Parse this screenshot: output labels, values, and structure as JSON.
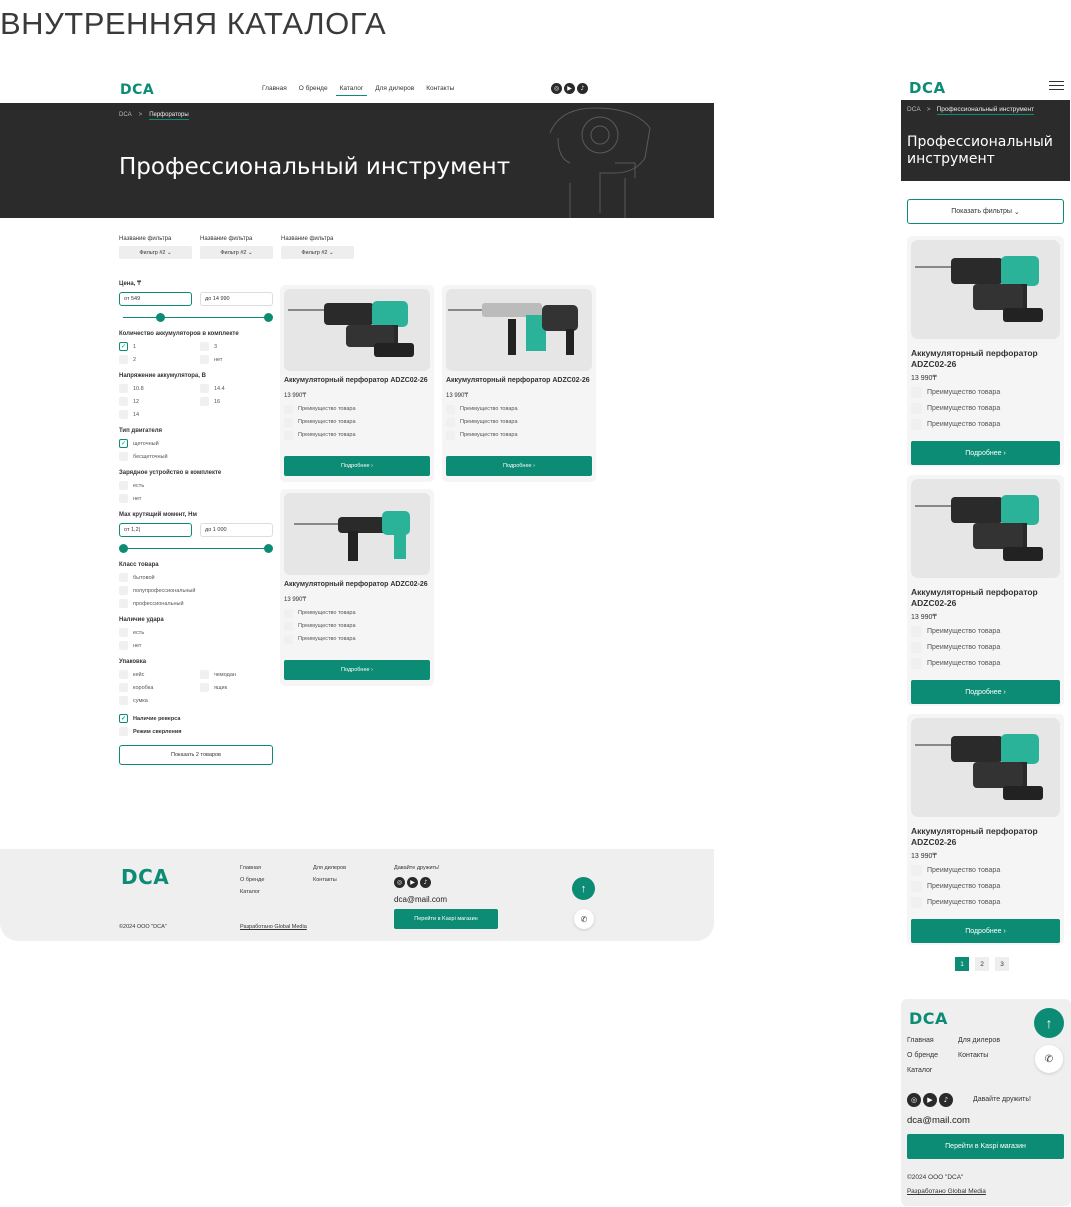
{
  "page_title": "ВНУТРЕННЯЯ КАТАЛОГА",
  "brand": {
    "logo": "DCA",
    "accent": "#0c8c74",
    "dark": "#2b2b2b"
  },
  "nav": [
    "Главная",
    "О бренде",
    "Каталог",
    "Для дилеров",
    "Контакты"
  ],
  "social": [
    "instagram-icon",
    "youtube-icon",
    "tiktok-icon"
  ],
  "breadcrumb": {
    "home": "DCA",
    "sep": ">",
    "current": "Перфораторы"
  },
  "hero_title": "Профессиональный инструмент",
  "top_filters": [
    {
      "label": "Название фильтра",
      "value": "Фильтр #2"
    },
    {
      "label": "Название фильтра",
      "value": "Фильтр #2"
    },
    {
      "label": "Название фильтра",
      "value": "Фильтр #2"
    }
  ],
  "sidebar": {
    "price_label": "Цена, ₸",
    "price_from": "от 549",
    "price_to": "до 14 990",
    "batteries_label": "Количество аккумуляторов в комплекте",
    "batteries": [
      "1",
      "3",
      "2",
      "нет"
    ],
    "voltage_label": "Напряжение аккумулятора, В",
    "voltage": [
      "10.8",
      "14.4",
      "12",
      "16",
      "14"
    ],
    "motor_label": "Тип двигателя",
    "motor": [
      "щеточный",
      "бесщеточный"
    ],
    "charger_label": "Зарядное устройство в комплекте",
    "charger": [
      "есть",
      "нет"
    ],
    "torque_label": "Мах крутящий момент, Нм",
    "torque_from": "от 1,2|",
    "torque_to": "до 1 000",
    "class_label": "Класс товара",
    "class": [
      "бытовой",
      "полупрофессиональный",
      "профессиональный"
    ],
    "impact_label": "Наличие удара",
    "impact": [
      "есть",
      "нет"
    ],
    "pack_label": "Упаковка",
    "pack": [
      "кейс",
      "чемодан",
      "коробка",
      "ящик",
      "сумка"
    ],
    "reverse": "Наличие реверса",
    "drill_mode": "Режим сверления",
    "show_button": "Показать 2 товаров"
  },
  "product": {
    "name": "Аккумуляторный перфоратор ADZC02-26",
    "price": "13 990₸",
    "advantage": "Преимущество товара",
    "button": "Подробнее"
  },
  "mobile": {
    "show_filters": "Показать фильтры",
    "pages": [
      "1",
      "2",
      "3"
    ]
  },
  "footer": {
    "friends": "Давайте дружить!",
    "email": "dca@mail.com",
    "kaspi": "Перейти в Kaspi магазин",
    "copyright": "©2024 ООО \"DCA\"",
    "developer": "Разработано Global Media"
  }
}
